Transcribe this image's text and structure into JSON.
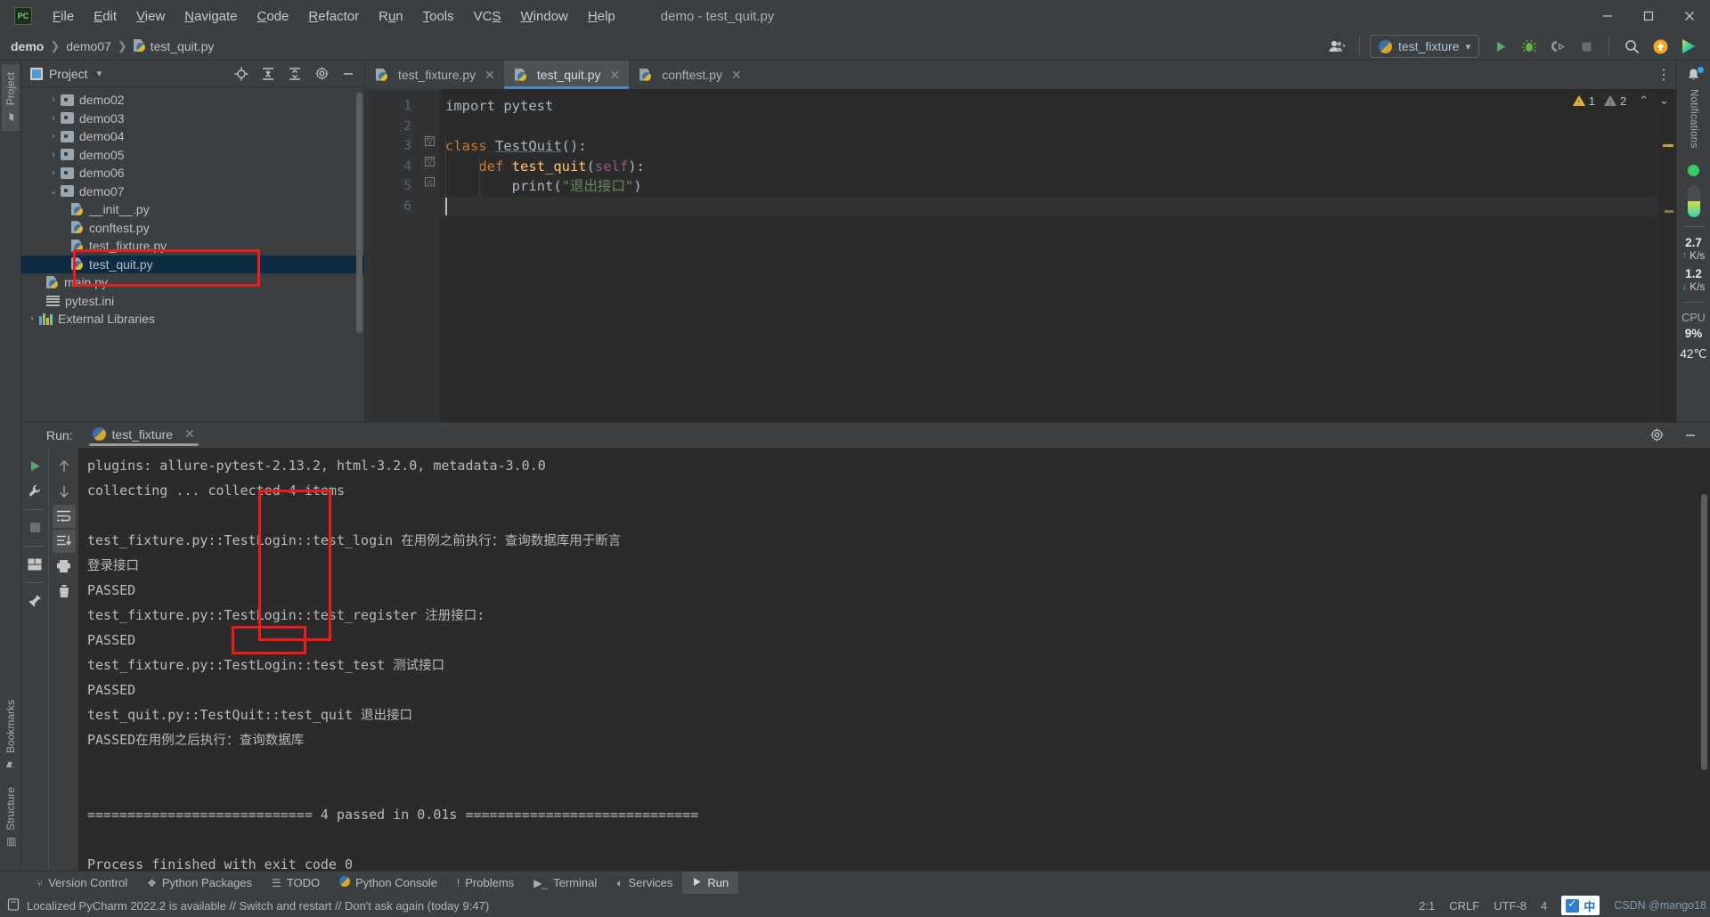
{
  "window": {
    "title": "demo - test_quit.py",
    "minimize": "—",
    "maximize": "❐",
    "close": "✕"
  },
  "menubar": {
    "logo": "PC",
    "items": [
      "File",
      "Edit",
      "View",
      "Navigate",
      "Code",
      "Refactor",
      "Run",
      "Tools",
      "VCS",
      "Window",
      "Help"
    ]
  },
  "breadcrumb": {
    "project": "demo",
    "folder": "demo07",
    "file": "test_quit.py",
    "separator": "❯"
  },
  "toolbar": {
    "account_icon": "user-icon",
    "run_config": "test_fixture",
    "dropdown_caret": "▾",
    "run_icon": "▶",
    "debug_icon": "debug-bug-icon",
    "coverage_icon": "run-coverage-icon",
    "stop_icon": "■",
    "search_icon": "search-icon",
    "update_icon": "update-icon",
    "ai_icon": "plugin-icon"
  },
  "left_strip": {
    "tabs": [
      "Project",
      "Bookmarks",
      "Structure"
    ],
    "active": "Project"
  },
  "project_panel": {
    "title": "Project",
    "caret": "▾",
    "header_icons": [
      "locate-icon",
      "expand-all-icon",
      "collapse-all-icon",
      "settings-icon",
      "hide-icon"
    ],
    "tree": [
      {
        "label": "demo02",
        "type": "folder",
        "indent": 1,
        "arrow": "›",
        "selected": false
      },
      {
        "label": "demo03",
        "type": "folder",
        "indent": 1,
        "arrow": "›",
        "selected": false
      },
      {
        "label": "demo04",
        "type": "folder",
        "indent": 1,
        "arrow": "›",
        "selected": false
      },
      {
        "label": "demo05",
        "type": "folder",
        "indent": 1,
        "arrow": "›",
        "selected": false
      },
      {
        "label": "demo06",
        "type": "folder",
        "indent": 1,
        "arrow": "›",
        "selected": false
      },
      {
        "label": "demo07",
        "type": "folder",
        "indent": 1,
        "arrow": "⌄",
        "selected": false
      },
      {
        "label": "__init__.py",
        "type": "python",
        "indent": 2,
        "arrow": "",
        "selected": false
      },
      {
        "label": "conftest.py",
        "type": "python",
        "indent": 2,
        "arrow": "",
        "selected": false
      },
      {
        "label": "test_fixture.py",
        "type": "python",
        "indent": 2,
        "arrow": "",
        "selected": false
      },
      {
        "label": "test_quit.py",
        "type": "python",
        "indent": 2,
        "arrow": "",
        "selected": true
      },
      {
        "label": "main.py",
        "type": "python",
        "indent": 1,
        "arrow": "",
        "selected": false
      },
      {
        "label": "pytest.ini",
        "type": "ini",
        "indent": 1,
        "arrow": "",
        "selected": false
      },
      {
        "label": "External Libraries",
        "type": "libraries",
        "indent": 0,
        "arrow": "›",
        "selected": false
      }
    ]
  },
  "editor": {
    "tabs": [
      {
        "label": "test_fixture.py",
        "active": false,
        "close": "✕"
      },
      {
        "label": "test_quit.py",
        "active": true,
        "close": "✕"
      },
      {
        "label": "conftest.py",
        "active": false,
        "close": "✕"
      }
    ],
    "more_icon": "⋮",
    "line_numbers": [
      "1",
      "2",
      "3",
      "4",
      "5",
      "6"
    ],
    "code_lines": [
      {
        "n": 1,
        "tokens": [
          {
            "t": "import pytest",
            "c": "k-imp"
          }
        ]
      },
      {
        "n": 2,
        "tokens": [
          {
            "t": "",
            "c": "k-plain"
          }
        ]
      },
      {
        "n": 3,
        "tokens": [
          {
            "t": "class ",
            "c": "k-orange"
          },
          {
            "t": "TestQuit",
            "c": "k-class"
          },
          {
            "t": "():",
            "c": "k-plain"
          }
        ]
      },
      {
        "n": 4,
        "tokens": [
          {
            "t": "    def ",
            "c": "k-orange"
          },
          {
            "t": "test_quit",
            "c": "k-fn"
          },
          {
            "t": "(",
            "c": "k-plain"
          },
          {
            "t": "self",
            "c": "k-self"
          },
          {
            "t": "):",
            "c": "k-plain"
          }
        ]
      },
      {
        "n": 5,
        "tokens": [
          {
            "t": "        print(",
            "c": "k-blue"
          },
          {
            "t": "\"退出接口\"",
            "c": "k-str"
          },
          {
            "t": ")",
            "c": "k-plain"
          }
        ]
      },
      {
        "n": 6,
        "tokens": [
          {
            "t": "",
            "c": "k-plain"
          }
        ]
      }
    ],
    "warnings": {
      "error_count": "1",
      "warning_count": "2",
      "up": "⌃",
      "down": "⌄"
    }
  },
  "right_strip": {
    "notifications_label": "Notifications",
    "bell_icon": "bell-icon",
    "network_up_value": "2.7",
    "network_up_unit": "K/s",
    "network_down_value": "1.2",
    "network_down_unit": "K/s",
    "cpu_label": "CPU",
    "cpu_value": "9%",
    "temp_value": "42℃"
  },
  "run_panel": {
    "label": "Run:",
    "tab": "test_fixture",
    "tab_close": "✕",
    "settings_icon": "settings-icon",
    "hide_icon": "—",
    "left_tools": [
      "run-icon",
      "rerun-failed-icon",
      "stop-icon",
      "layout-icon",
      "pin-icon"
    ],
    "right_tools": [
      "up-arrow-icon",
      "down-arrow-icon",
      "soft-wrap-icon",
      "scroll-to-end-icon",
      "print-icon",
      "clear-all-icon"
    ],
    "console_lines": [
      "plugins: allure-pytest-2.13.2, html-3.2.0, metadata-3.0.0",
      "collecting ... collected 4 items",
      "",
      "test_fixture.py::TestLogin::test_login 在用例之前执行：查询数据库用于断言",
      "登录接口",
      "PASSED",
      "test_fixture.py::TestLogin::test_register 注册接口:",
      "PASSED",
      "test_fixture.py::TestLogin::test_test 测试接口",
      "PASSED",
      "test_quit.py::TestQuit::test_quit 退出接口",
      "PASSED在用例之后执行：查询数据库",
      "",
      "",
      "============================ 4 passed in 0.01s =============================",
      "",
      "Process finished with exit code 0"
    ]
  },
  "bottom_toolbar": {
    "items": [
      {
        "label": "Version Control",
        "icon": "branch-icon",
        "active": false
      },
      {
        "label": "Python Packages",
        "icon": "packages-icon",
        "active": false
      },
      {
        "label": "TODO",
        "icon": "todo-icon",
        "active": false
      },
      {
        "label": "Python Console",
        "icon": "python-icon",
        "active": false
      },
      {
        "label": "Problems",
        "icon": "problems-icon",
        "active": false
      },
      {
        "label": "Terminal",
        "icon": "terminal-icon",
        "active": false
      },
      {
        "label": "Services",
        "icon": "services-icon",
        "active": false
      },
      {
        "label": "Run",
        "icon": "run-icon",
        "active": true
      }
    ]
  },
  "statusbar": {
    "icon": "event-log-icon",
    "message": "Localized PyCharm 2022.2 is available // Switch and restart // Don't ask again (today 9:47)",
    "caret_position": "2:1",
    "line_separator": "CRLF",
    "encoding": "UTF-8",
    "indent": "4",
    "ime_label": "中",
    "watermark": "CSDN @mango18"
  }
}
